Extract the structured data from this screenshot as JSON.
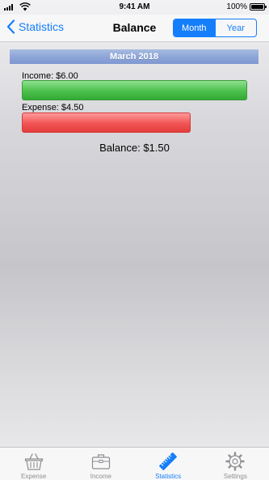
{
  "status_bar": {
    "time": "9:41 AM",
    "battery_percent": "100%"
  },
  "nav": {
    "back_label": "Statistics",
    "title": "Balance",
    "segments": [
      {
        "label": "Month",
        "selected": true
      },
      {
        "label": "Year",
        "selected": false
      }
    ]
  },
  "report": {
    "period": "March 2018",
    "income_label": "Income: $6.00",
    "income_value": 6.0,
    "expense_label": "Expense: $4.50",
    "expense_value": 4.5,
    "balance_label": "Balance: $1.50",
    "colors": {
      "income": "#4cc04c",
      "expense": "#f25555",
      "header": "#8ea6d8",
      "accent": "#157efb"
    }
  },
  "tabs": [
    {
      "label": "Expense",
      "icon": "basket-icon",
      "selected": false
    },
    {
      "label": "Income",
      "icon": "briefcase-icon",
      "selected": false
    },
    {
      "label": "Statistics",
      "icon": "ruler-icon",
      "selected": true
    },
    {
      "label": "Settings",
      "icon": "gear-icon",
      "selected": false
    }
  ]
}
